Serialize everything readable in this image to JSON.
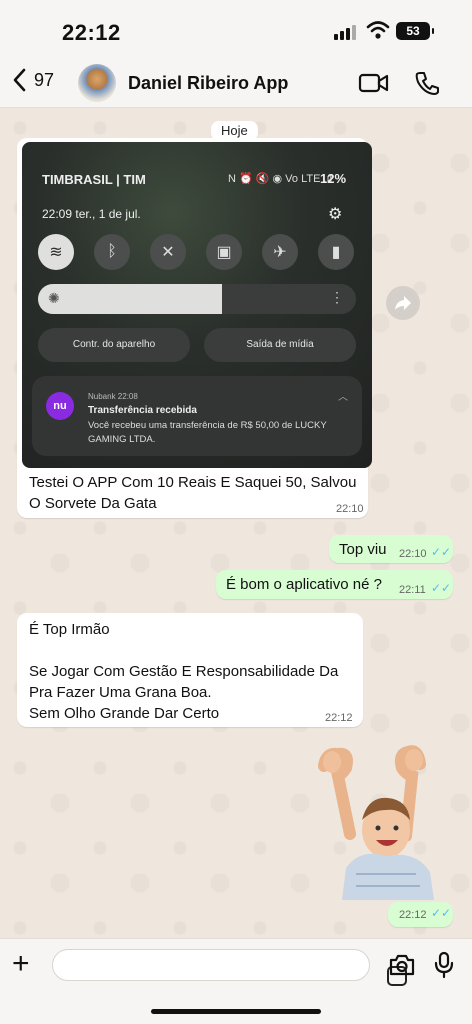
{
  "status_bar": {
    "time": "22:12",
    "battery": "53"
  },
  "header": {
    "back_count": "97",
    "contact_name": "Daniel Ribeiro App"
  },
  "date_chip": "Hoje",
  "screenshot": {
    "carrier": "TIMBRASIL | TIM",
    "status_icons": "N ⏰ 🔇 ◉ Vo LTE .ıl",
    "battery_pct": "12%",
    "datetime": "22:09  ter., 1 de jul.",
    "brightness_level": 0.58,
    "pill_left": "Contr. do aparelho",
    "pill_right": "Saída de mídia",
    "notification": {
      "logo": "nu",
      "app": "Nubank  22:08",
      "title": "Transferência recebida",
      "body": "Você recebeu uma transferência de R$ 50,00 de LUCKY GAMING LTDA."
    }
  },
  "messages": [
    {
      "dir": "in",
      "text": "Testei O APP Com 10 Reais E Saquei 50, Salvou O Sorvete Da Gata",
      "time": "22:10"
    },
    {
      "dir": "out",
      "text": "Top viu",
      "time": "22:10"
    },
    {
      "dir": "out",
      "text": "É bom o aplicativo né ?",
      "time": "22:11"
    },
    {
      "dir": "in",
      "text": "É Top Irmão\n\nSe Jogar Com Gestão E Responsabilidade Da Pra Fazer Uma Grana Boa.\nSem Olho Grande Dar Certo",
      "time": "22:12"
    },
    {
      "dir": "out",
      "text": "",
      "time": "22:12"
    }
  ],
  "colors": {
    "incoming": "#ffffff",
    "outgoing": "#d9fdd3",
    "read_ticks": "#53bdeb"
  }
}
